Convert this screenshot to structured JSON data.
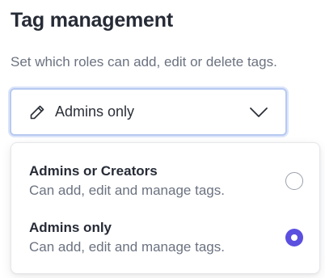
{
  "header": {
    "title": "Tag management",
    "subtitle": "Set which roles can add, edit or delete tags."
  },
  "select": {
    "value": "Admins only",
    "icon": "pencil-icon",
    "chevron_icon": "chevron-down-icon",
    "focus_ring_color": "#b7c9f0"
  },
  "dropdown": {
    "options": [
      {
        "title": "Admins or Creators",
        "description": "Can add, edit and manage tags.",
        "selected": false
      },
      {
        "title": "Admins only",
        "description": "Can add, edit and manage tags.",
        "selected": true
      }
    ],
    "selected_color": "#5b4fe0"
  }
}
